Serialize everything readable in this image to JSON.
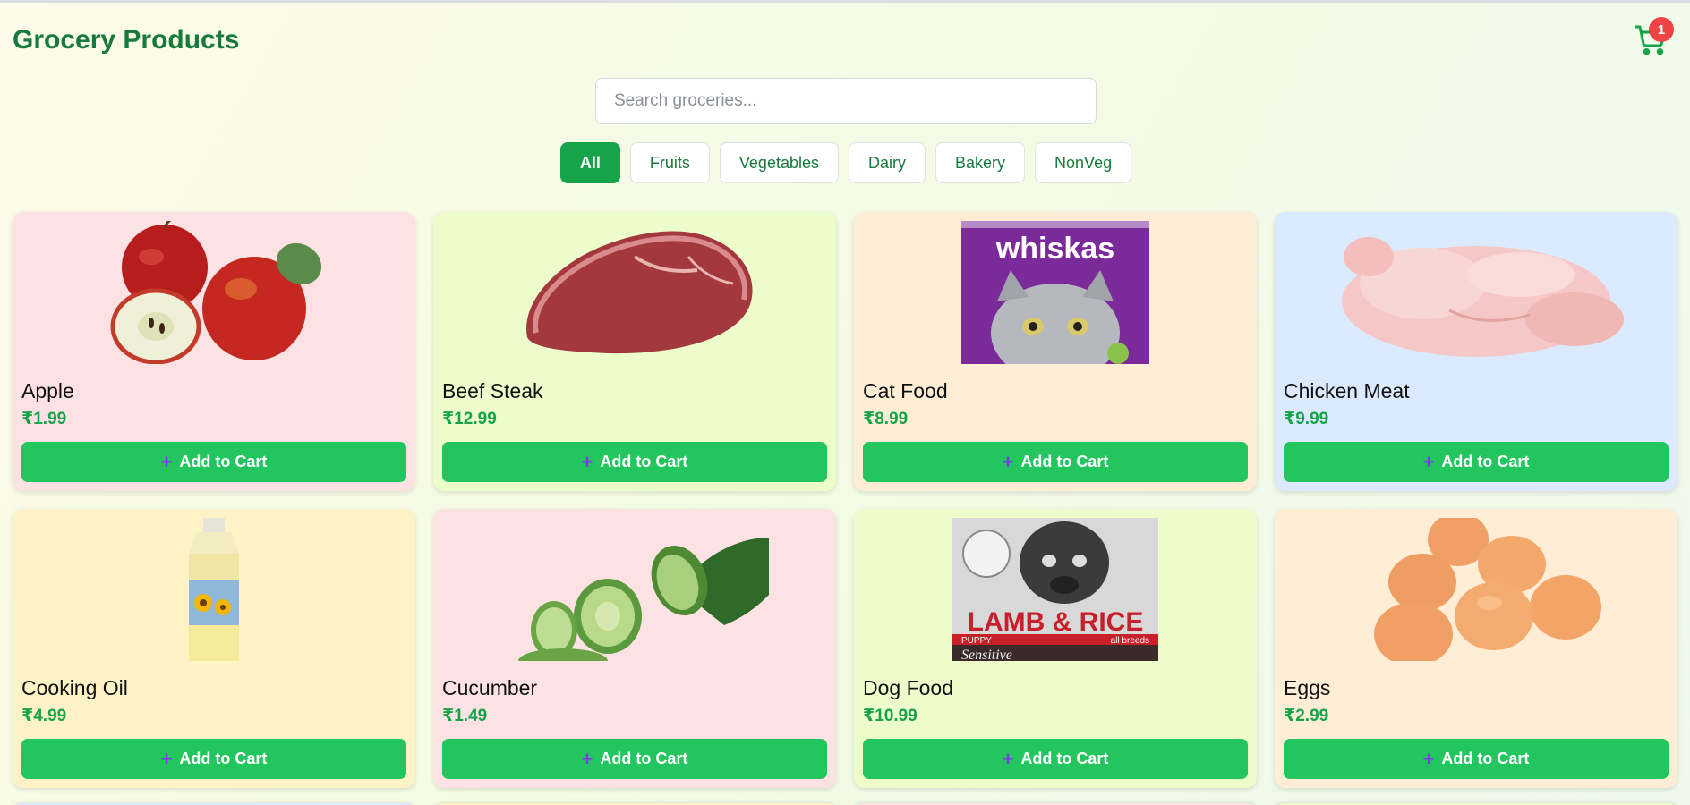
{
  "header": {
    "title": "Grocery Products",
    "cart_count": "1"
  },
  "search": {
    "placeholder": "Search groceries..."
  },
  "filters": [
    "All",
    "Fruits",
    "Vegetables",
    "Dairy",
    "Bakery",
    "NonVeg"
  ],
  "active_filter": "All",
  "add_label": "Add to Cart",
  "plus_symbol": "+",
  "products": [
    {
      "name": "Apple",
      "price": "₹1.99",
      "bg": "#fde2e4",
      "img": "apple"
    },
    {
      "name": "Beef Steak",
      "price": "₹12.99",
      "bg": "#ecfccb",
      "img": "steak"
    },
    {
      "name": "Cat Food",
      "price": "₹8.99",
      "bg": "#ffedd5",
      "img": "catfood"
    },
    {
      "name": "Chicken Meat",
      "price": "₹9.99",
      "bg": "#dbeafe",
      "img": "chicken"
    },
    {
      "name": "Cooking Oil",
      "price": "₹4.99",
      "bg": "#fef3c7",
      "img": "oil"
    },
    {
      "name": "Cucumber",
      "price": "₹1.49",
      "bg": "#fde2e4",
      "img": "cucumber"
    },
    {
      "name": "Dog Food",
      "price": "₹10.99",
      "bg": "#ecfccb",
      "img": "dogfood"
    },
    {
      "name": "Eggs",
      "price": "₹2.99",
      "bg": "#ffedd5",
      "img": "eggs"
    }
  ],
  "product_image_text": {
    "catfood_brand": "whiskas",
    "dogfood_line1": "LAMB & RICE",
    "dogfood_line2": "PUPPY",
    "dogfood_line3": "all breeds",
    "dogfood_line4": "Sensitive"
  },
  "colors": {
    "accent": "#22c55e",
    "title": "#177a3c",
    "badge": "#ef4444",
    "plus": "#7c3aed"
  },
  "peek_colors": [
    "#dbeafe",
    "#fef3c7",
    "#fde2e4",
    "#ecfccb"
  ]
}
